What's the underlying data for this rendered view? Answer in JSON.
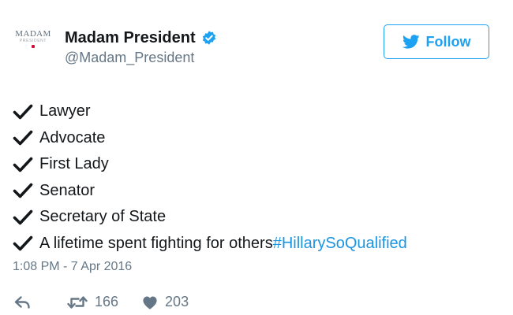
{
  "account": {
    "avatar_text": "MADAM",
    "avatar_subtext": "PRESIDENT",
    "display_name": "Madam President",
    "handle": "@Madam_President"
  },
  "follow_button": {
    "label": "Follow"
  },
  "tweet": {
    "lines": [
      {
        "text": "Lawyer"
      },
      {
        "text": "Advocate"
      },
      {
        "text": "First Lady"
      },
      {
        "text": "Senator"
      },
      {
        "text": "Secretary of State"
      },
      {
        "text": "A lifetime spent fighting for others",
        "hashtag": "#HillarySoQualified"
      }
    ],
    "timestamp": "1:08 PM - 7 Apr 2016"
  },
  "actions": {
    "retweet_count": "166",
    "like_count": "203"
  },
  "colors": {
    "accent": "#1da1f2",
    "hashtag": "#1b95e0",
    "secondary_text": "#657786",
    "primary_text": "#14171a"
  },
  "icons": [
    "verified-badge-icon",
    "bird-icon",
    "check-icon",
    "reply-icon",
    "retweet-icon",
    "heart-icon"
  ]
}
